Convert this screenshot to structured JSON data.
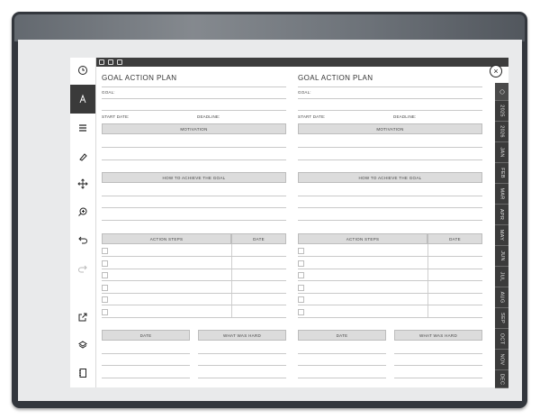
{
  "planner": {
    "pages": [
      {
        "title": "GOAL ACTION PLAN",
        "goal_label": "GOAL:",
        "start_label": "START DATE:",
        "deadline_label": "DEADLINE:",
        "motivation": "MOTIVATION",
        "how": "HOW TO ACHIEVE THE GOAL",
        "action_steps": "ACTION STEPS",
        "date": "DATE",
        "bottom_date": "DATE",
        "hard": "WHAT WAS HARD"
      },
      {
        "title": "GOAL ACTION PLAN",
        "goal_label": "GOAL:",
        "start_label": "START DATE:",
        "deadline_label": "DEADLINE:",
        "motivation": "MOTIVATION",
        "how": "HOW TO ACHIEVE THE GOAL",
        "action_steps": "ACTION STEPS",
        "date": "DATE",
        "bottom_date": "DATE",
        "hard": "WHAT WAS HARD"
      }
    ]
  },
  "tabs": [
    "2025",
    "2026",
    "JAN",
    "FEB",
    "MAR",
    "APR",
    "MAY",
    "JUN",
    "JUL",
    "AUG",
    "SEP",
    "OCT",
    "NOV",
    "DEC"
  ],
  "close_glyph": "×",
  "toolbar": [
    "clock-icon",
    "pen-icon",
    "menu-lines-icon",
    "eraser-icon",
    "move-icon",
    "zoom-icon",
    "undo-icon",
    "redo-icon",
    "share-icon",
    "layers-icon",
    "notebook-icon"
  ]
}
